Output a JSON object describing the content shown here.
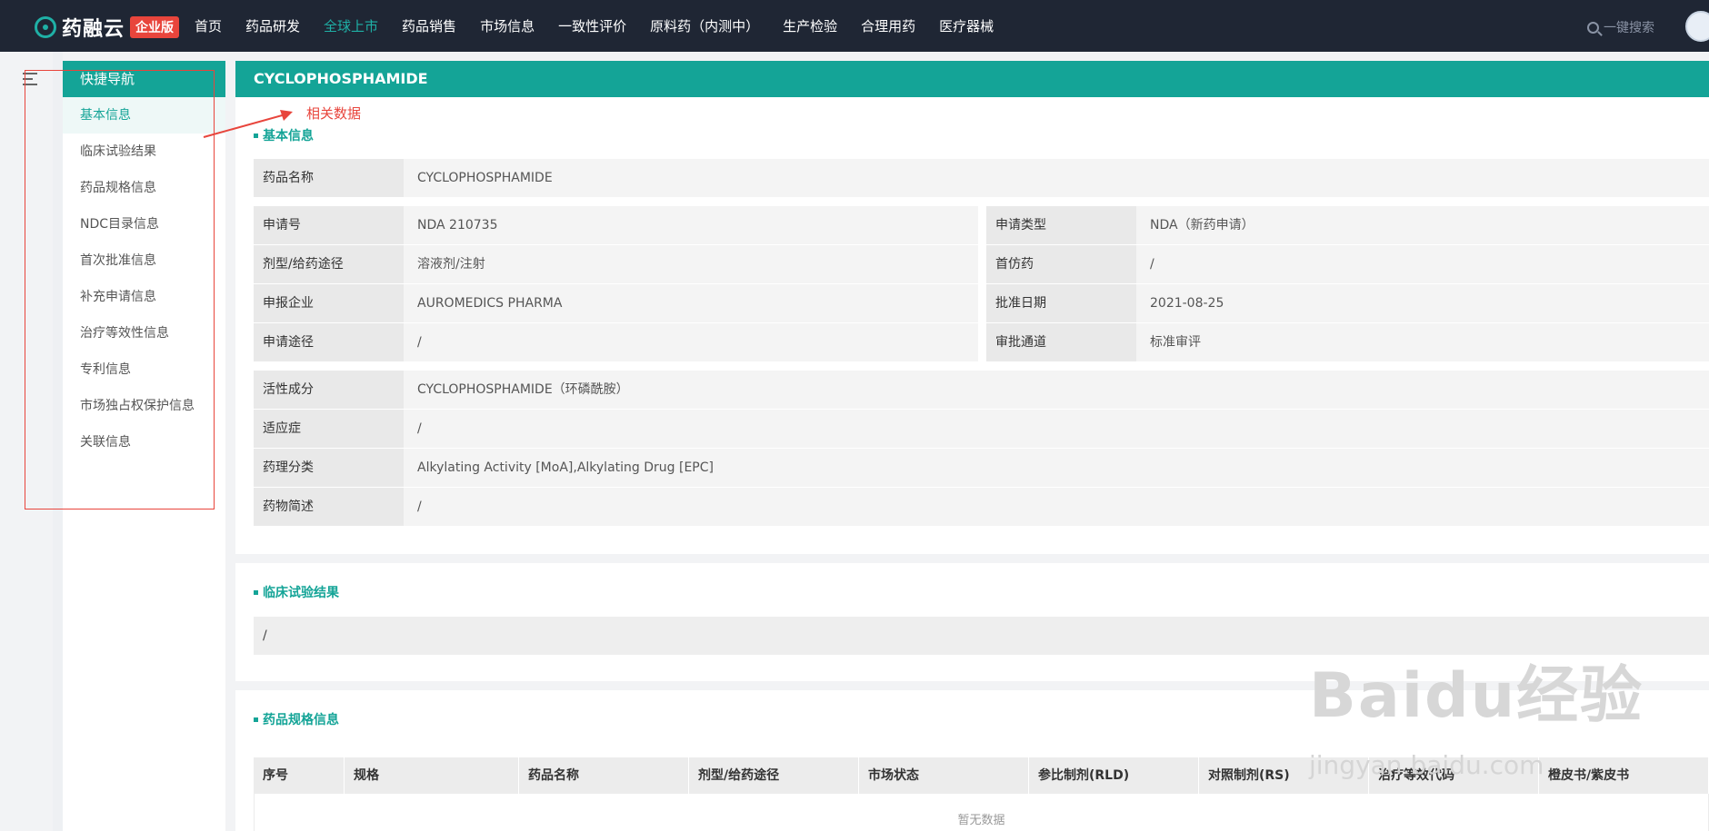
{
  "header": {
    "logo_text": "药融云",
    "logo_badge": "企业版",
    "nav": [
      "首页",
      "药品研发",
      "全球上市",
      "药品销售",
      "市场信息",
      "一致性评价",
      "原料药（内测中）",
      "生产检验",
      "合理用药",
      "医疗器械"
    ],
    "active_nav": "全球上市",
    "search_label": "一键搜索"
  },
  "sidenav": {
    "title": "快捷导航",
    "items": [
      "基本信息",
      "临床试验结果",
      "药品规格信息",
      "NDC目录信息",
      "首次批准信息",
      "补充申请信息",
      "治疗等效性信息",
      "专利信息",
      "市场独占权保护信息",
      "关联信息"
    ],
    "active": "基本信息"
  },
  "annotation": "相关数据",
  "drug": {
    "title": "CYCLOPHOSPHAMIDE",
    "section_basic": "基本信息",
    "name_label": "药品名称",
    "name_value": "CYCLOPHOSPHAMIDE",
    "left": [
      {
        "label": "申请号",
        "value": "NDA 210735"
      },
      {
        "label": "剂型/给药途径",
        "value": "溶液剂/注射"
      },
      {
        "label": "申报企业",
        "value": "AUROMEDICS PHARMA"
      },
      {
        "label": "申请途径",
        "value": "/"
      }
    ],
    "right": [
      {
        "label": "申请类型",
        "value": "NDA（新药申请）"
      },
      {
        "label": "首仿药",
        "value": "/"
      },
      {
        "label": "批准日期",
        "value": "2021-08-25"
      },
      {
        "label": "审批通道",
        "value": "标准审评"
      }
    ],
    "bottom": [
      {
        "label": "活性成分",
        "value": "CYCLOPHOSPHAMIDE（环磷酰胺）"
      },
      {
        "label": "适应症",
        "value": "/"
      },
      {
        "label": "药理分类",
        "value": "Alkylating Activity [MoA],Alkylating Drug [EPC]"
      },
      {
        "label": "药物简述",
        "value": "/"
      }
    ]
  },
  "clinical": {
    "title": "临床试验结果",
    "value": "/"
  },
  "specs": {
    "title": "药品规格信息",
    "columns": [
      "序号",
      "规格",
      "药品名称",
      "剂型/给药途径",
      "市场状态",
      "参比制剂(RLD)",
      "对照制剂(RS)",
      "治疗等效代码",
      "橙皮书/紫皮书"
    ],
    "empty_text": "暂无数据"
  },
  "watermark": {
    "text": "Baidu经验",
    "url": "jingyan.baidu.com"
  }
}
